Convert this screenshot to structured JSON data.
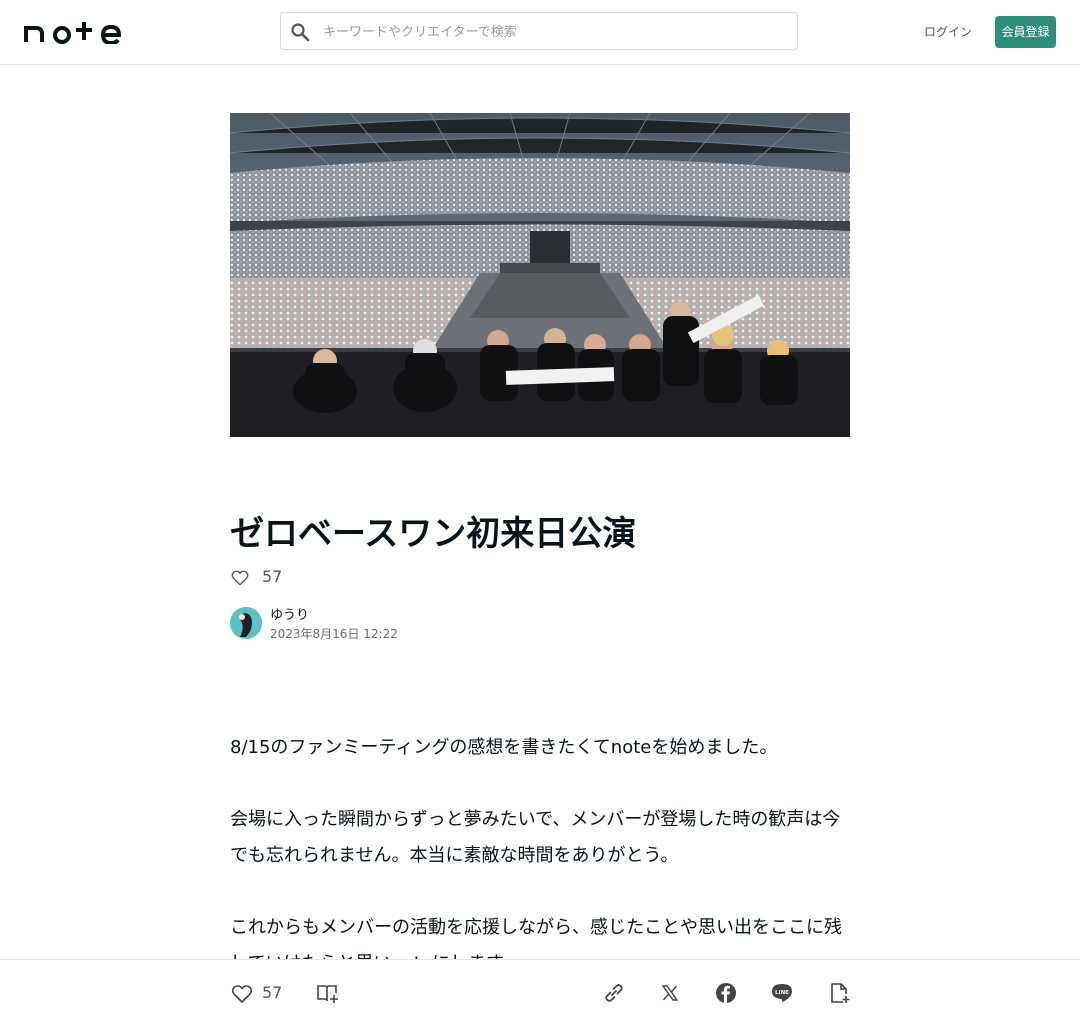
{
  "header": {
    "logo_text": "note",
    "search_placeholder": "キーワードやクリエイターで検索",
    "login_label": "ログイン",
    "signup_label": "会員登録"
  },
  "article": {
    "hero_image": "hero-concert-photo",
    "title": "ゼロベースワン初来日公演",
    "likes": "57",
    "author_name": "ゆうり",
    "date": "2023年8月16日 12:22",
    "paragraphs": [
      "8/15のファンミーティングの感想を書きたくてnoteを始めました。",
      "会場に入った瞬間からずっと夢みたいで、メンバーが登場した時の歓声は今でも忘れられません。本当に素敵な時間をありがとう。",
      "これからもメンバーの活動を応援しながら、感じたことや思い出をここに残していけたらと思いnoteにします"
    ]
  },
  "bottom_bar": {
    "likes": "57",
    "icons": [
      "heart-icon",
      "magazine-add-icon",
      "link-icon",
      "x-icon",
      "facebook-icon",
      "line-icon",
      "note-add-icon"
    ]
  },
  "colors": {
    "accent": "#2b8f7a",
    "text": "#08131a",
    "muted": "#6b6b6b",
    "border": "#e6e6e6"
  }
}
